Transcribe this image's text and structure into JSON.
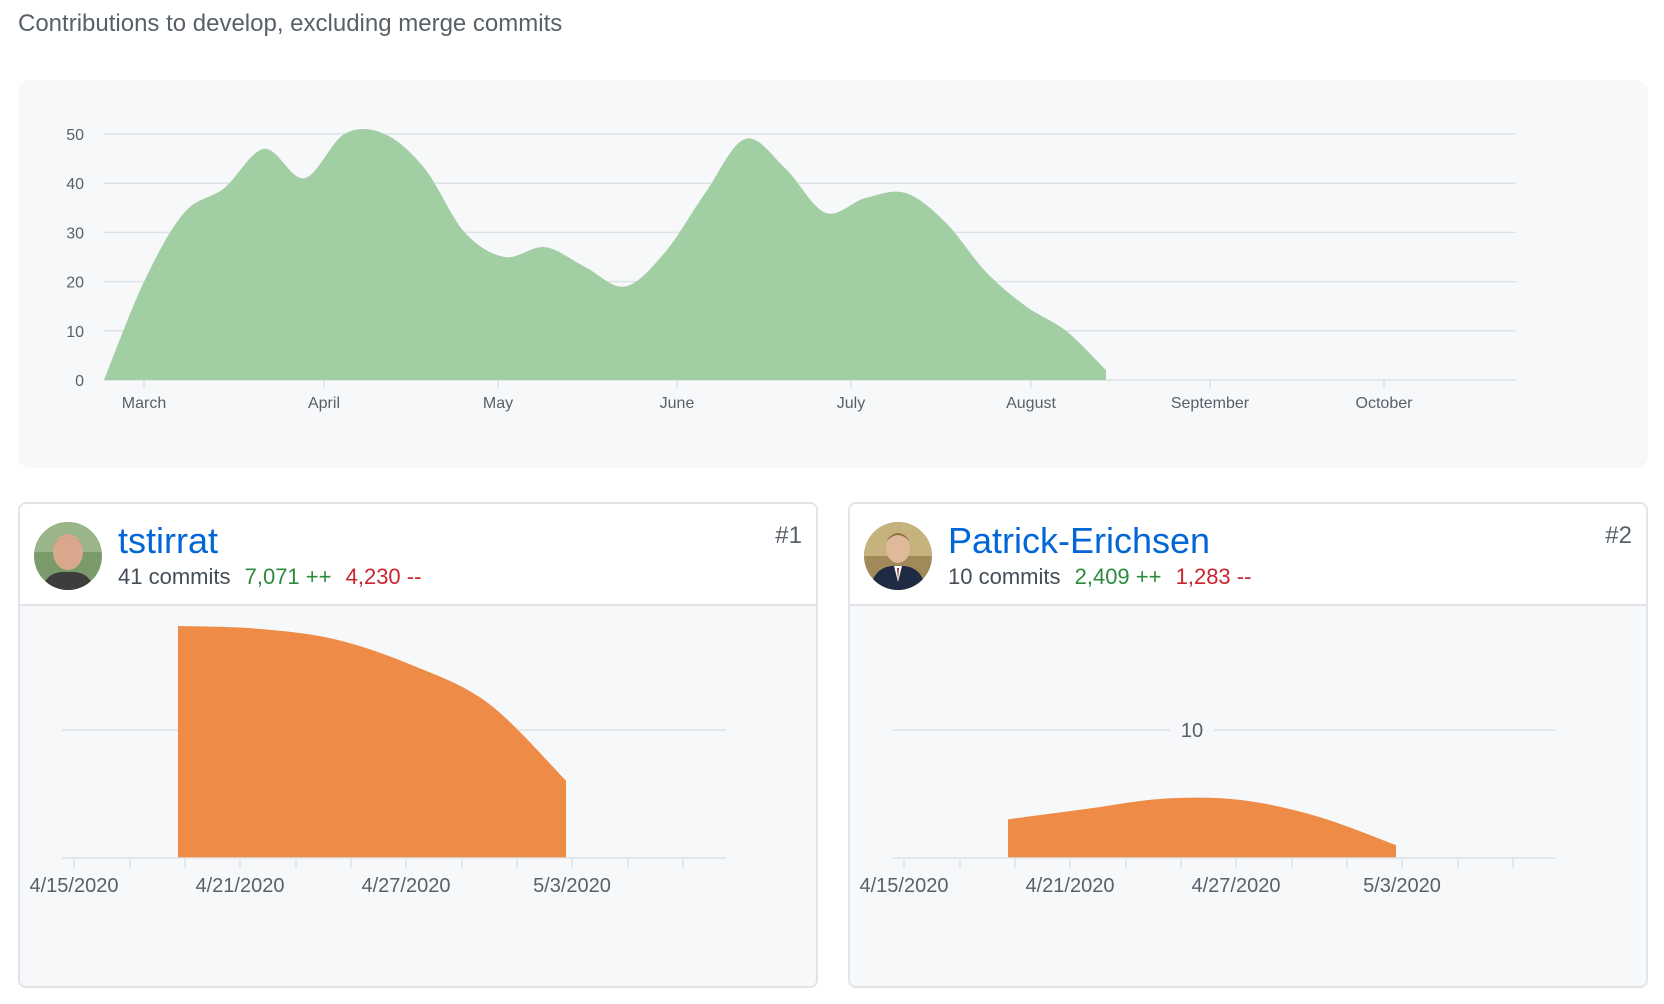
{
  "caption": "Contributions to develop, excluding merge commits",
  "colors": {
    "main_area": "#a2cea4",
    "contributor_area": "#ed8b47",
    "grid": "#dfe2e5"
  },
  "chart_data": [
    {
      "type": "area",
      "title": "",
      "xlabel": "",
      "ylabel": "",
      "x_ticks": [
        "March",
        "April",
        "May",
        "June",
        "July",
        "August",
        "September",
        "October"
      ],
      "y_ticks": [
        0,
        10,
        20,
        30,
        40,
        50
      ],
      "ylim": [
        0,
        50
      ],
      "grid": true,
      "series": [
        {
          "x": [
            "Feb 23",
            "Mar 1",
            "Mar 8",
            "Mar 15",
            "Mar 22",
            "Mar 29",
            "Apr 5",
            "Apr 12",
            "Apr 19",
            "Apr 26",
            "May 3",
            "May 10",
            "May 17",
            "May 24",
            "May 31",
            "Jun 7",
            "Jun 14",
            "Jun 21",
            "Jun 28",
            "Jul 5",
            "Jul 12",
            "Jul 19",
            "Jul 26",
            "Aug 2",
            "Aug 9",
            "Aug 16"
          ],
          "values": [
            0,
            20,
            34,
            39,
            47,
            41,
            50,
            50,
            43,
            30,
            25,
            27,
            23,
            19,
            26,
            38,
            49,
            43,
            34,
            37,
            38,
            32,
            22,
            15,
            10,
            2
          ]
        }
      ]
    }
  ],
  "contributors": [
    {
      "rank": "#1",
      "username": "tstirrat",
      "commits": "41 commits",
      "additions": "7,071 ++",
      "deletions": "4,230 --",
      "chart": {
        "type": "area",
        "x_ticks": [
          "4/15/2020",
          "4/21/2020",
          "4/27/2020",
          "5/3/2020"
        ],
        "gridline_label": "",
        "x": [
          "4/19/2020",
          "4/21/2020",
          "4/24/2020",
          "4/27/2020",
          "4/30/2020",
          "5/3/2020"
        ],
        "values": [
          18,
          17.8,
          17,
          15,
          12,
          6
        ],
        "ylim": [
          0,
          18
        ]
      }
    },
    {
      "rank": "#2",
      "username": "Patrick-Erichsen",
      "commits": "10 commits",
      "additions": "2,409 ++",
      "deletions": "1,283 --",
      "chart": {
        "type": "area",
        "x_ticks": [
          "4/15/2020",
          "4/21/2020",
          "4/27/2020",
          "5/3/2020"
        ],
        "gridline_label": "10",
        "x": [
          "4/19/2020",
          "4/21/2020",
          "4/24/2020",
          "4/27/2020",
          "4/30/2020",
          "5/3/2020"
        ],
        "values": [
          3,
          3.8,
          4.6,
          4.5,
          3.2,
          1
        ],
        "ylim": [
          0,
          18
        ]
      }
    }
  ]
}
